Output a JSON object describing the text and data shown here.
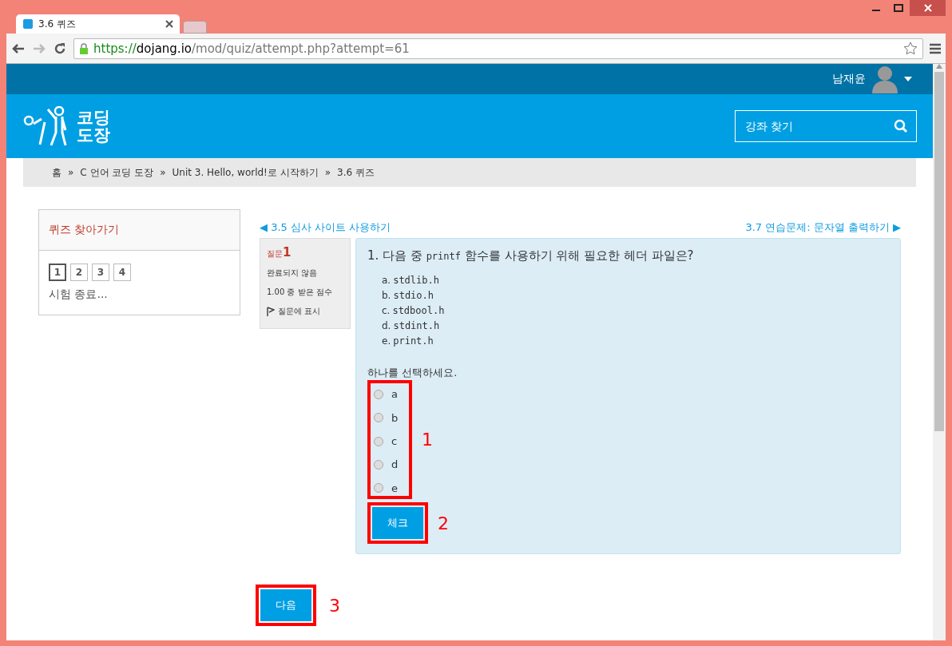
{
  "browser": {
    "tab_title": "3.6 퀴즈",
    "url_host_prefix": "https://",
    "url_host": "dojang.io",
    "url_path": "/mod/quiz/attempt.php?attempt=61"
  },
  "user": {
    "name": "남재윤"
  },
  "logo": {
    "line1": "코딩",
    "line2": "도장"
  },
  "search": {
    "placeholder": "강좌 찾기"
  },
  "breadcrumb": [
    "홈",
    "C 언어 코딩 도장",
    "Unit 3. Hello, world!로 시작하기",
    "3.6 퀴즈"
  ],
  "breadcrumb_separator": "»",
  "quiz_nav": {
    "title": "퀴즈 찾아가기",
    "pages": [
      {
        "label": "1",
        "selected": true
      },
      {
        "label": "2",
        "selected": false
      },
      {
        "label": "3",
        "selected": false
      },
      {
        "label": "4",
        "selected": false
      }
    ],
    "finish": "시험 종료..."
  },
  "prev_link": {
    "arrow": "◀",
    "label": "3.5 심사 사이트 사용하기"
  },
  "next_link": {
    "label": "3.7 연습문제: 문자열 출력하기",
    "arrow": "▶"
  },
  "question_info": {
    "prefix": "질문",
    "number": "1",
    "status": "완료되지 않음",
    "score": "1.00 중 받은 점수",
    "flag": "질문에 표시"
  },
  "question": {
    "before": "1. 다음 중 ",
    "code": "printf",
    "after": " 함수를 사용하기 위해 필요한 헤더 파일은?",
    "options": [
      {
        "letter": "a.",
        "text": "stdlib.h"
      },
      {
        "letter": "b.",
        "text": "stdio.h"
      },
      {
        "letter": "c.",
        "text": "stdbool.h"
      },
      {
        "letter": "d.",
        "text": "stdint.h"
      },
      {
        "letter": "e.",
        "text": "print.h"
      }
    ],
    "prompt": "하나를 선택하세요.",
    "choices": [
      {
        "label": "a",
        "selected": false
      },
      {
        "label": "b",
        "selected": false
      },
      {
        "label": "c",
        "selected": false
      },
      {
        "label": "d",
        "selected": false
      },
      {
        "label": "e",
        "selected": false
      }
    ],
    "check_button": "체크"
  },
  "next_button": "다음",
  "annotations": [
    "1",
    "2",
    "3"
  ]
}
